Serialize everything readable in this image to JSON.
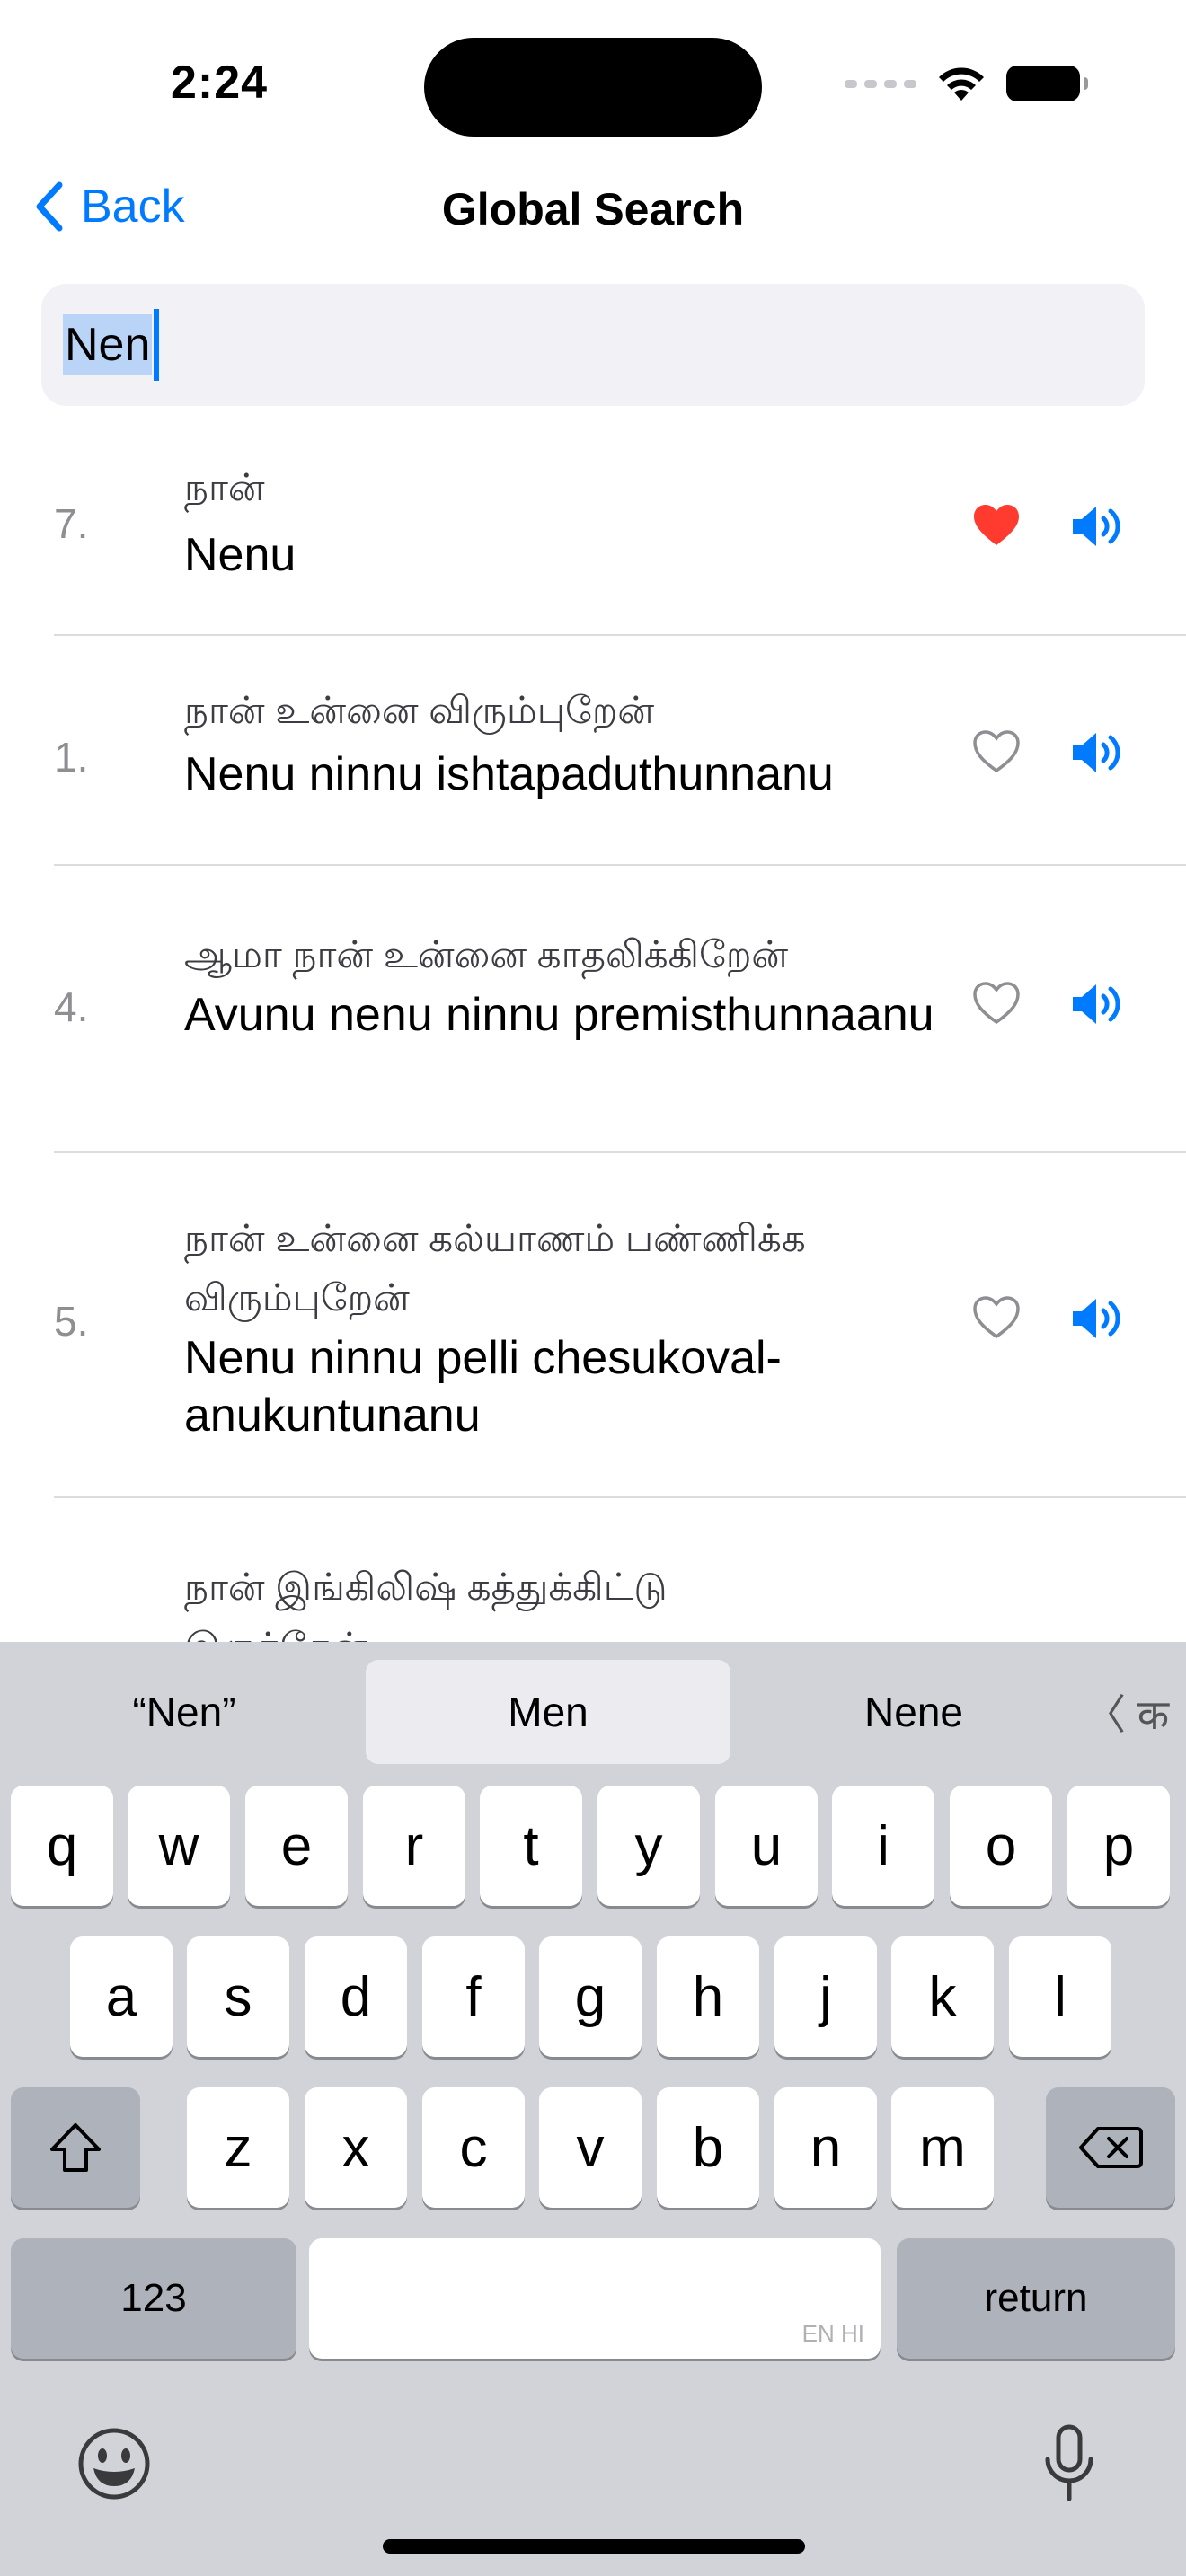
{
  "status": {
    "time": "2:24"
  },
  "nav": {
    "back_label": "Back",
    "title": "Global Search"
  },
  "search": {
    "value": "Nen"
  },
  "results": [
    {
      "number": "7.",
      "tamil": "நான்",
      "telugu": "Nenu",
      "favorite": true
    },
    {
      "number": "1.",
      "tamil": "நான் உன்னை விரும்புறேன்",
      "telugu": "Nenu ninnu ishtapaduthunnanu",
      "favorite": false
    },
    {
      "number": "4.",
      "tamil": "ஆமா நான் உன்னை காதலிக்கிறேன்",
      "telugu": "Avunu nenu ninnu premisthunnaanu",
      "favorite": false
    },
    {
      "number": "5.",
      "tamil": "நான் உன்னை கல்யாணம் பண்ணிக்க விரும்புறேன்",
      "telugu": "Nenu ninnu pelli chesukoval-anukuntunanu",
      "favorite": false
    },
    {
      "number": "",
      "tamil": "நான் இங்கிலிஷ் கத்துக்கிட்டு இருக்கேன்",
      "telugu": "",
      "favorite": false
    }
  ],
  "keyboard": {
    "suggestions": [
      "“Nen”",
      "Men",
      "Nene"
    ],
    "lang_switch": "〈 क",
    "row1": [
      "q",
      "w",
      "e",
      "r",
      "t",
      "y",
      "u",
      "i",
      "o",
      "p"
    ],
    "row2": [
      "a",
      "s",
      "d",
      "f",
      "g",
      "h",
      "j",
      "k",
      "l"
    ],
    "row3": [
      "z",
      "x",
      "c",
      "v",
      "b",
      "n",
      "m"
    ],
    "numbers_label": "123",
    "return_label": "return",
    "space_lang": "EN HI"
  },
  "colors": {
    "accent": "#007aff",
    "heart_active": "#ff3b30",
    "heart_inactive": "#8e8e93"
  }
}
